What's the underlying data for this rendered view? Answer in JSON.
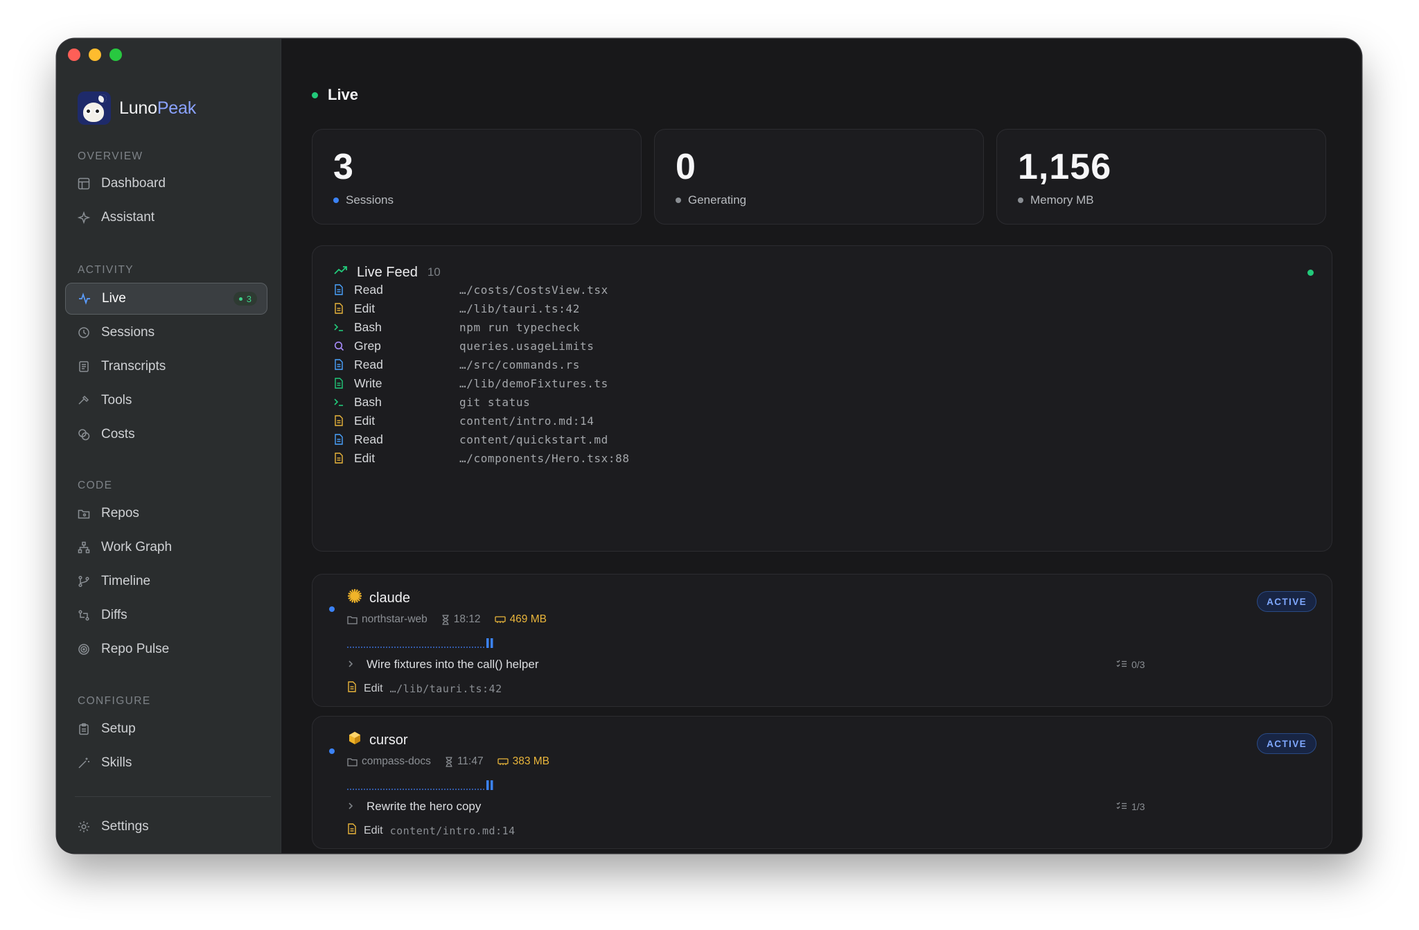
{
  "app": {
    "brand_first": "Luno",
    "brand_second": "Peak"
  },
  "sidebar": {
    "sections": {
      "overview": "OVERVIEW",
      "activity": "ACTIVITY",
      "code": "CODE",
      "configure": "CONFIGURE"
    },
    "items": {
      "dashboard": "Dashboard",
      "assistant": "Assistant",
      "live": "Live",
      "live_badge": "3",
      "sessions": "Sessions",
      "transcripts": "Transcripts",
      "tools": "Tools",
      "costs": "Costs",
      "repos": "Repos",
      "work_graph": "Work Graph",
      "timeline": "Timeline",
      "diffs": "Diffs",
      "repo_pulse": "Repo Pulse",
      "setup": "Setup",
      "skills": "Skills",
      "settings": "Settings"
    }
  },
  "main": {
    "title": "Live",
    "stats": [
      {
        "value": "3",
        "label": "Sessions",
        "dot_color": "#3b82f6"
      },
      {
        "value": "0",
        "label": "Generating",
        "dot_color": "#8a8e93"
      },
      {
        "value": "1,156",
        "label": "Memory MB",
        "dot_color": "#8a8e93"
      }
    ],
    "feed": {
      "title": "Live Feed",
      "count": "10",
      "rows": [
        {
          "tool": "Read",
          "path": "…/costs/CostsView.tsx",
          "icon": "file-icon",
          "color": "#4aa3ff"
        },
        {
          "tool": "Edit",
          "path": "…/lib/tauri.ts:42",
          "icon": "file-edit-icon",
          "color": "#e9b53b"
        },
        {
          "tool": "Bash",
          "path": "npm run typecheck",
          "icon": "terminal-icon",
          "color": "#22c97a"
        },
        {
          "tool": "Grep",
          "path": "queries.usageLimits",
          "icon": "search-icon",
          "color": "#a78bfa"
        },
        {
          "tool": "Read",
          "path": "…/src/commands.rs",
          "icon": "file-icon",
          "color": "#4aa3ff"
        },
        {
          "tool": "Write",
          "path": "…/lib/demoFixtures.ts",
          "icon": "file-write-icon",
          "color": "#22c97a"
        },
        {
          "tool": "Bash",
          "path": "git status",
          "icon": "terminal-icon",
          "color": "#22c97a"
        },
        {
          "tool": "Edit",
          "path": "content/intro.md:14",
          "icon": "file-edit-icon",
          "color": "#e9b53b"
        },
        {
          "tool": "Read",
          "path": "content/quickstart.md",
          "icon": "file-icon",
          "color": "#4aa3ff"
        },
        {
          "tool": "Edit",
          "path": "…/components/Hero.tsx:88",
          "icon": "file-edit-icon",
          "color": "#e9b53b"
        }
      ]
    },
    "sessions": [
      {
        "name": "claude",
        "repo": "northstar-web",
        "duration": "18:12",
        "memory": "469 MB",
        "status": "ACTIVE",
        "task": "Wire fixtures into the call() helper",
        "progress": "0/3",
        "last_tool": "Edit",
        "last_path": "…/lib/tauri.ts:42"
      },
      {
        "name": "cursor",
        "repo": "compass-docs",
        "duration": "11:47",
        "memory": "383 MB",
        "status": "ACTIVE",
        "task": "Rewrite the hero copy",
        "progress": "1/3",
        "last_tool": "Edit",
        "last_path": "content/intro.md:14"
      }
    ]
  }
}
